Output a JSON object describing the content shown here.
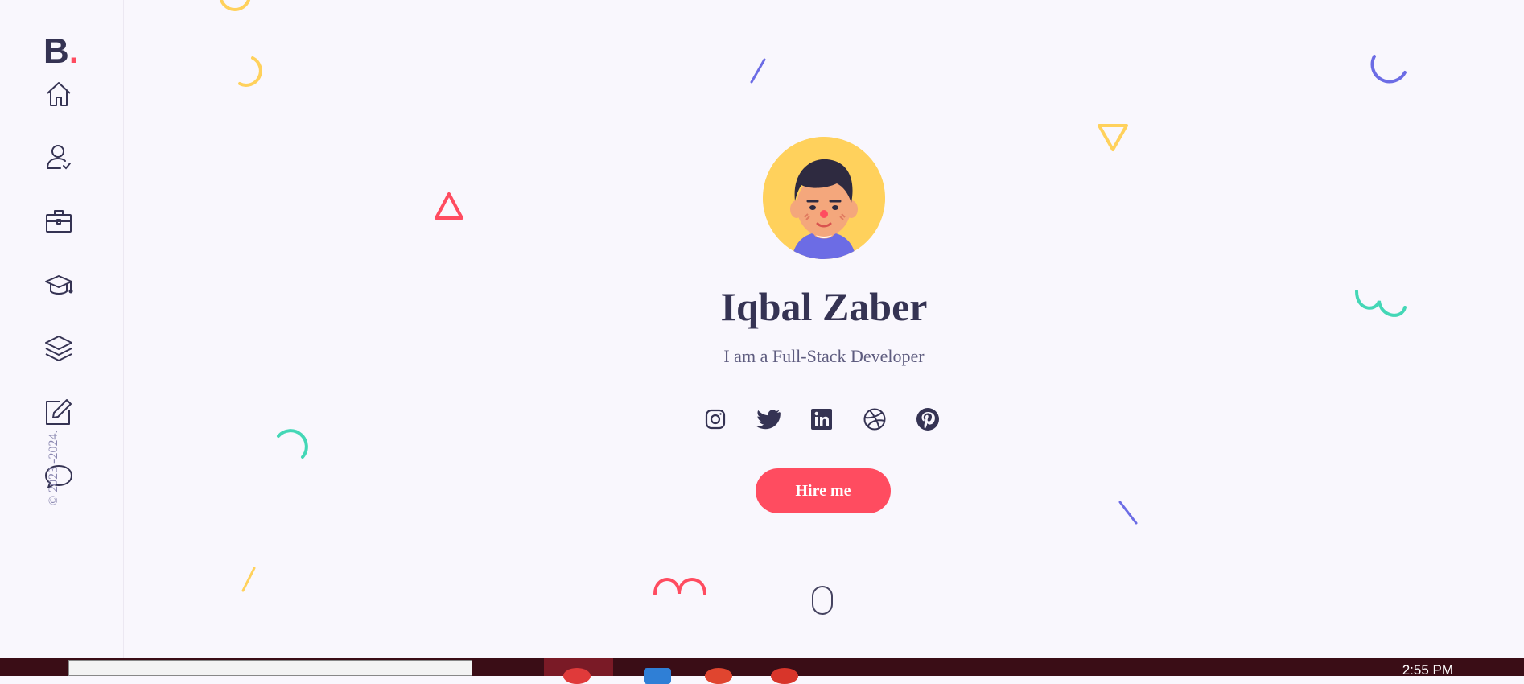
{
  "sidebar": {
    "logo_letter": "B",
    "logo_dot": ".",
    "copyright": "© 2023 -2024.",
    "nav": [
      {
        "name": "home",
        "icon": "home-icon"
      },
      {
        "name": "about",
        "icon": "user-check-icon"
      },
      {
        "name": "services",
        "icon": "briefcase-icon"
      },
      {
        "name": "experience",
        "icon": "graduation-cap-icon"
      },
      {
        "name": "works",
        "icon": "layers-icon"
      },
      {
        "name": "blog",
        "icon": "edit-icon"
      },
      {
        "name": "contact",
        "icon": "chat-bubble-icon"
      }
    ]
  },
  "hero": {
    "name": "Iqbal Zaber",
    "tagline": "I am a Full-Stack Developer",
    "hire_label": "Hire me",
    "socials": [
      "instagram-icon",
      "twitter-icon",
      "linkedin-icon",
      "dribbble-icon",
      "pinterest-icon"
    ]
  },
  "taskbar": {
    "clock": "2:55 PM"
  },
  "colors": {
    "accent": "#ff4c60",
    "dark": "#353353",
    "yellow": "#ffd15c",
    "green": "#44d7b6",
    "blue": "#6c6ce5",
    "background": "#f9f7fd"
  }
}
